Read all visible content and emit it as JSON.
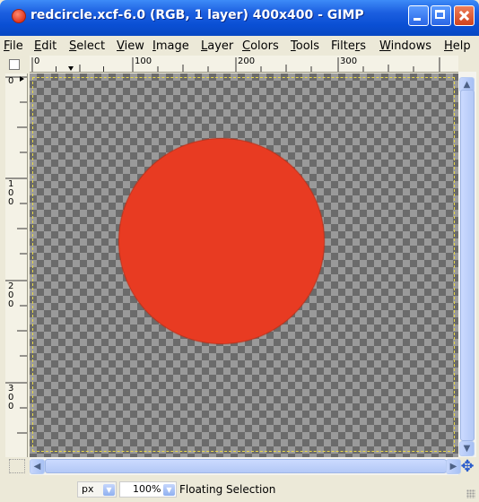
{
  "window": {
    "title": "redcircle.xcf-6.0 (RGB, 1 layer) 400x400 - GIMP",
    "app_icon": "gimp-red-dot-icon"
  },
  "menubar": {
    "items": [
      {
        "key": "F",
        "rest": "ile"
      },
      {
        "key": "E",
        "rest": "dit"
      },
      {
        "key": "S",
        "rest": "elect"
      },
      {
        "key": "V",
        "rest": "iew"
      },
      {
        "key": "I",
        "rest": "mage"
      },
      {
        "key": "L",
        "rest": "ayer"
      },
      {
        "key": "C",
        "rest": "olors"
      },
      {
        "key": "T",
        "rest": "ools"
      },
      {
        "key": "",
        "pre": "Filte",
        "ul": "r",
        "rest": "s"
      },
      {
        "key": "W",
        "rest": "indows"
      },
      {
        "key": "H",
        "rest": "elp"
      }
    ]
  },
  "rulers": {
    "horizontal_labels": [
      "0",
      "100",
      "200",
      "300"
    ],
    "vertical_labels": [
      "0",
      "100",
      "200",
      "300"
    ]
  },
  "canvas": {
    "fill_color": "#e83b22",
    "shape": "circle",
    "background": "transparency-checkerboard"
  },
  "statusbar": {
    "unit": "px",
    "zoom": "100%",
    "message": "Floating Selection"
  },
  "colors": {
    "titlebar": "#0a4fd4",
    "circle": "#e83b22",
    "selection_border": "#e8d84a"
  }
}
